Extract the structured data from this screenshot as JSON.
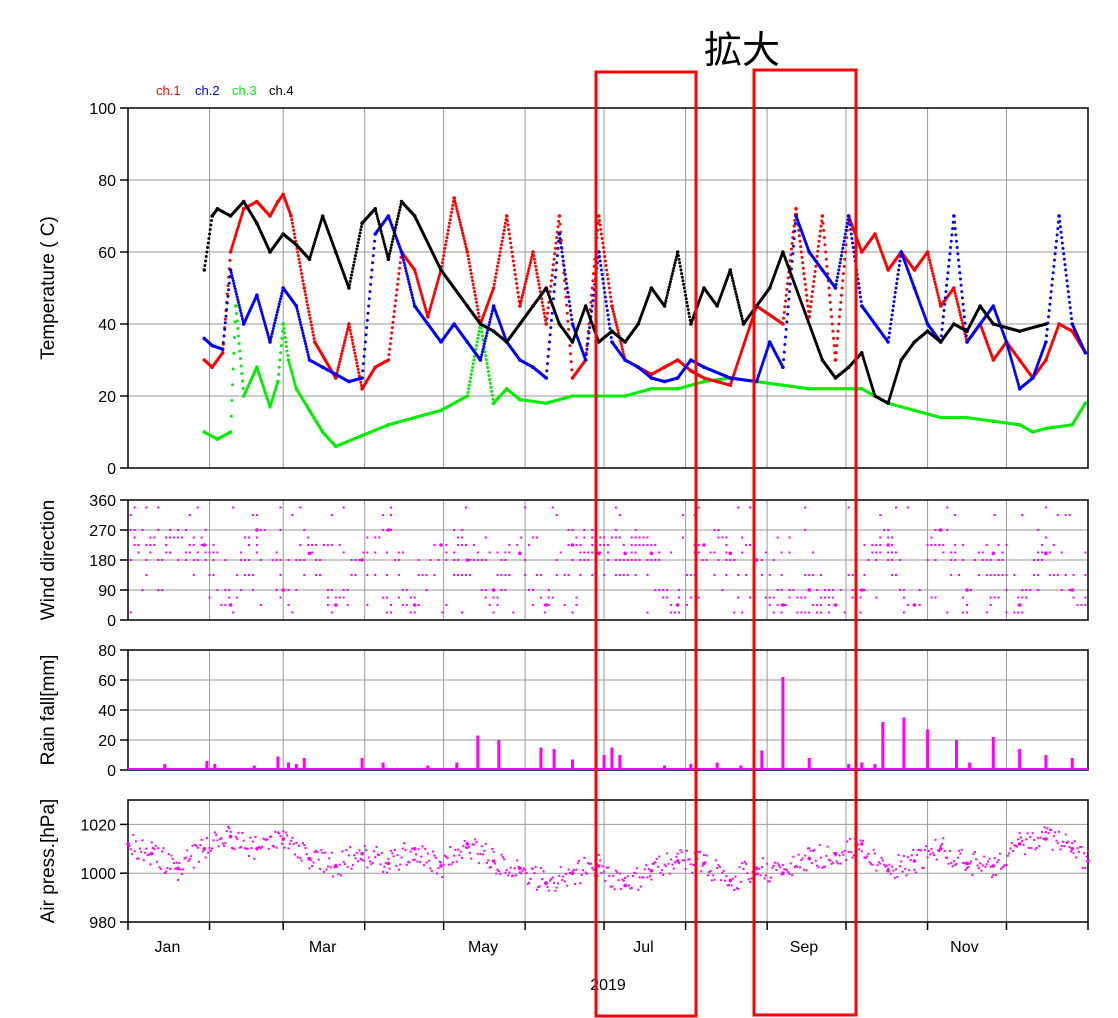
{
  "annotation": "拡大",
  "colors": {
    "ch1": "#ff0000",
    "ch2": "#0000ff",
    "ch3": "#00ee00",
    "ch4": "#000000",
    "met": "#ff00ff",
    "highlight": "#ff0000",
    "grid": "#9a9a9a"
  },
  "legend": [
    "ch.1",
    "ch.2",
    "ch.3",
    "ch.4"
  ],
  "chart_data": [
    {
      "type": "scatter",
      "ylabel": "Temperature ( C)",
      "xlim": [
        1,
        366
      ],
      "ylim": [
        0,
        100
      ],
      "yticks": [
        "0",
        "20",
        "40",
        "60",
        "80",
        "100"
      ],
      "series": [
        {
          "name": "ch.1",
          "x": [
            30,
            33,
            37,
            40,
            45,
            50,
            55,
            58,
            60,
            63,
            68,
            72,
            76,
            80,
            85,
            90,
            95,
            100,
            105,
            110,
            115,
            120,
            125,
            130,
            135,
            140,
            145,
            150,
            155,
            160,
            165,
            170,
            175,
            180,
            185,
            190,
            195,
            200,
            205,
            210,
            215,
            220,
            225,
            230,
            240,
            250,
            255,
            260,
            265,
            270,
            275,
            280,
            285,
            290,
            295,
            300,
            305,
            310,
            315,
            320,
            325,
            330,
            335,
            340,
            345,
            350,
            355,
            360,
            365
          ],
          "y": [
            30,
            28,
            32,
            60,
            72,
            74,
            70,
            74,
            76,
            70,
            50,
            35,
            30,
            25,
            40,
            22,
            28,
            30,
            60,
            55,
            42,
            55,
            75,
            60,
            40,
            50,
            70,
            45,
            60,
            40,
            70,
            25,
            30,
            70,
            45,
            30,
            28,
            26,
            28,
            30,
            27,
            25,
            24,
            23,
            45,
            40,
            72,
            42,
            70,
            30,
            70,
            60,
            65,
            55,
            60,
            55,
            60,
            45,
            50,
            35,
            40,
            30,
            35,
            30,
            25,
            30,
            40,
            38,
            32
          ]
        },
        {
          "name": "ch.2",
          "x": [
            30,
            33,
            37,
            40,
            45,
            50,
            55,
            60,
            65,
            70,
            75,
            80,
            85,
            90,
            95,
            100,
            105,
            110,
            115,
            120,
            125,
            130,
            135,
            140,
            145,
            150,
            155,
            160,
            165,
            170,
            175,
            180,
            185,
            190,
            195,
            200,
            205,
            210,
            215,
            220,
            230,
            240,
            245,
            250,
            255,
            260,
            265,
            270,
            275,
            280,
            285,
            290,
            295,
            300,
            305,
            310,
            315,
            320,
            325,
            330,
            335,
            340,
            345,
            350,
            355,
            360,
            365
          ],
          "y": [
            36,
            34,
            33,
            55,
            40,
            48,
            35,
            50,
            45,
            30,
            28,
            26,
            24,
            25,
            65,
            70,
            60,
            45,
            40,
            35,
            40,
            35,
            30,
            45,
            35,
            30,
            28,
            25,
            65,
            40,
            30,
            60,
            35,
            30,
            28,
            25,
            24,
            25,
            30,
            28,
            25,
            24,
            35,
            28,
            70,
            60,
            55,
            50,
            70,
            45,
            40,
            35,
            60,
            50,
            40,
            35,
            70,
            35,
            40,
            45,
            35,
            22,
            25,
            35,
            70,
            40,
            32
          ]
        },
        {
          "name": "ch.3",
          "x": [
            30,
            35,
            40,
            42,
            45,
            50,
            55,
            58,
            60,
            62,
            65,
            70,
            75,
            80,
            90,
            100,
            110,
            120,
            130,
            135,
            140,
            145,
            150,
            160,
            170,
            180,
            190,
            200,
            210,
            220,
            230,
            240,
            250,
            260,
            270,
            280,
            290,
            300,
            310,
            320,
            330,
            340,
            345,
            350,
            360,
            365
          ],
          "y": [
            10,
            8,
            10,
            45,
            20,
            28,
            17,
            24,
            40,
            30,
            22,
            16,
            10,
            6,
            9,
            12,
            14,
            16,
            20,
            40,
            18,
            22,
            19,
            18,
            20,
            20,
            20,
            22,
            22,
            24,
            25,
            24,
            23,
            22,
            22,
            22,
            18,
            16,
            14,
            14,
            13,
            12,
            10,
            11,
            12,
            18
          ]
        },
        {
          "name": "ch.4",
          "x": [
            30,
            33,
            35,
            40,
            45,
            50,
            55,
            60,
            65,
            70,
            75,
            80,
            85,
            90,
            95,
            100,
            105,
            110,
            120,
            130,
            135,
            140,
            145,
            150,
            155,
            160,
            165,
            170,
            175,
            180,
            185,
            190,
            195,
            200,
            205,
            210,
            215,
            220,
            225,
            230,
            235,
            240,
            245,
            250,
            265,
            270,
            275,
            280,
            285,
            290,
            295,
            300,
            305,
            310,
            315,
            320,
            325,
            330,
            340,
            350
          ],
          "y": [
            55,
            70,
            72,
            70,
            74,
            68,
            60,
            65,
            62,
            58,
            70,
            60,
            50,
            68,
            72,
            58,
            74,
            70,
            55,
            45,
            40,
            38,
            35,
            40,
            45,
            50,
            40,
            35,
            45,
            35,
            38,
            35,
            40,
            50,
            45,
            60,
            40,
            50,
            45,
            55,
            40,
            45,
            50,
            60,
            30,
            25,
            28,
            32,
            20,
            18,
            30,
            35,
            38,
            35,
            40,
            38,
            45,
            40,
            38,
            40
          ]
        }
      ]
    },
    {
      "type": "scatter",
      "ylabel": "Wind direction",
      "xlim": [
        1,
        366
      ],
      "ylim": [
        0,
        360
      ],
      "yticks": [
        "0",
        "90",
        "180",
        "270",
        "360"
      ],
      "series": [
        {
          "name": "",
          "x": [
            30,
            40,
            50,
            60,
            70,
            80,
            90,
            100,
            110,
            120,
            130,
            140,
            150,
            160,
            170,
            180,
            190,
            200,
            210,
            220,
            230,
            240,
            250,
            260,
            270,
            280,
            290,
            300,
            310,
            320,
            330,
            340,
            350,
            360
          ],
          "y": [
            225,
            45,
            270,
            90,
            200,
            45,
            180,
            270,
            45,
            225,
            180,
            90,
            200,
            45,
            225,
            200,
            200,
            200,
            45,
            225,
            200,
            180,
            45,
            90,
            45,
            90,
            225,
            45,
            270,
            90,
            200,
            45,
            200,
            90
          ]
        }
      ]
    },
    {
      "type": "bar",
      "ylabel": "Rain fall[mm]",
      "xlim": [
        1,
        366
      ],
      "ylim": [
        0,
        80
      ],
      "yticks": [
        "0",
        "20",
        "40",
        "60",
        "80"
      ],
      "x": [
        15,
        31,
        34,
        49,
        58,
        62,
        65,
        68,
        90,
        98,
        115,
        126,
        134,
        142,
        158,
        163,
        170,
        182,
        185,
        188,
        205,
        215,
        225,
        234,
        242,
        250,
        260,
        275,
        280,
        285,
        288,
        296,
        305,
        316,
        321,
        330,
        340,
        350,
        360
      ],
      "values": [
        4,
        6,
        4,
        3,
        9,
        5,
        4,
        8,
        8,
        5,
        3,
        5,
        23,
        20,
        15,
        14,
        7,
        10,
        15,
        10,
        3,
        4,
        5,
        3,
        13,
        62,
        8,
        4,
        5,
        4,
        32,
        35,
        27,
        20,
        5,
        22,
        14,
        10,
        8
      ]
    },
    {
      "type": "scatter",
      "ylabel": "Air press.[hPa]",
      "xlim": [
        1,
        366
      ],
      "ylim": [
        980,
        1030
      ],
      "yticks": [
        "980",
        "1000",
        "1020"
      ],
      "x_ticks": [
        "Jan",
        "Mar",
        "May",
        "Jul",
        "Sep",
        "Nov"
      ],
      "xlabel": "2019",
      "series": [
        {
          "name": "",
          "x": [
            1,
            10,
            20,
            30,
            40,
            50,
            60,
            70,
            80,
            90,
            100,
            110,
            120,
            130,
            140,
            150,
            160,
            170,
            180,
            190,
            200,
            210,
            220,
            230,
            240,
            250,
            260,
            270,
            280,
            290,
            300,
            310,
            320,
            330,
            340,
            350,
            360,
            366
          ],
          "y": [
            1012,
            1008,
            1002,
            1010,
            1015,
            1010,
            1014,
            1006,
            1003,
            1008,
            1004,
            1010,
            1003,
            1012,
            1005,
            1002,
            996,
            1000,
            1003,
            995,
            1001,
            1005,
            1004,
            997,
            1002,
            1000,
            1006,
            1008,
            1012,
            1001,
            1005,
            1010,
            1004,
            1003,
            1012,
            1014,
            1010,
            1005
          ]
        }
      ]
    }
  ]
}
